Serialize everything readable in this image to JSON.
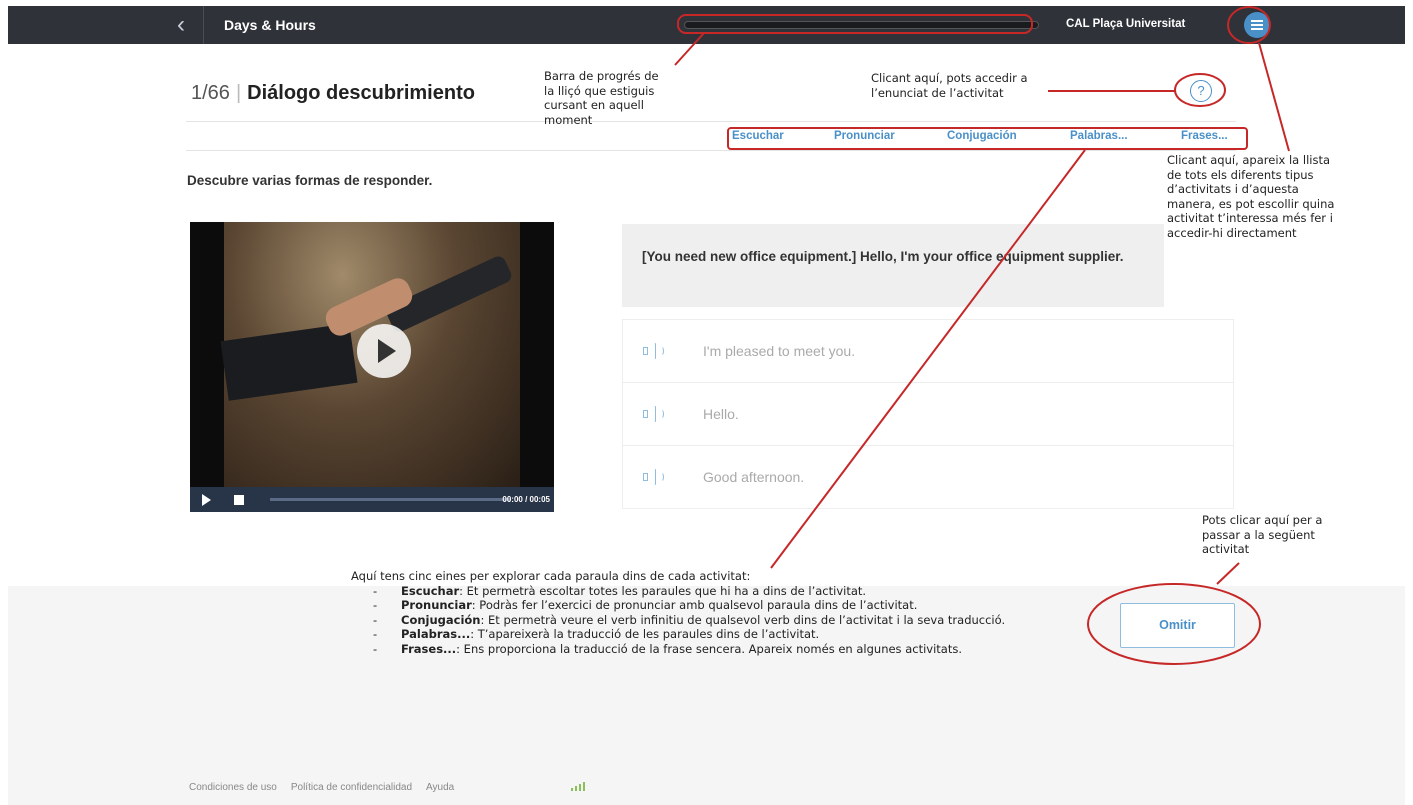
{
  "topbar": {
    "back_icon": "chevron-left-icon",
    "course_title": "Days & Hours",
    "school_name": "CAL Plaça Universitat",
    "menu_icon": "hamburger-menu-icon"
  },
  "lesson": {
    "counter": "1/66",
    "title": "Diálogo descubrimiento",
    "help_icon": "?",
    "instruction": "Descubre varias formas de responder."
  },
  "tools": [
    {
      "label": "Escuchar"
    },
    {
      "label": "Pronunciar"
    },
    {
      "label": "Conjugación"
    },
    {
      "label": "Palabras..."
    },
    {
      "label": "Frases..."
    }
  ],
  "video": {
    "time": "00:00 / 00:05"
  },
  "prompt": "[You need new office equipment.] Hello, I'm your office equipment supplier.",
  "answers": [
    {
      "text": "I'm pleased to meet you."
    },
    {
      "text": "Hello."
    },
    {
      "text": "Good afternoon."
    }
  ],
  "skip_label": "Omitir",
  "footer": {
    "links": [
      "Condiciones de uso",
      "Política de confidencialidad",
      "Ayuda"
    ]
  },
  "annotations": {
    "progress": [
      "Barra de progrés de",
      "la lliçó que estiguis",
      "cursant en aquell",
      "moment"
    ],
    "help": [
      "Clicant aquí, pots accedir a",
      "l’enunciat de l’activitat"
    ],
    "menu": [
      "Clicant aquí, apareix la llista",
      "de tots els diferents tipus",
      "d’activitats i d’aquesta",
      "manera, es pot escollir quina",
      "activitat t’interessa més fer i",
      "accedir-hi directament"
    ],
    "skip": [
      "Pots clicar aquí per a",
      "passar a la següent",
      "activitat"
    ],
    "tools_intro": "Aquí tens cinc eines per explorar cada paraula dins de cada activitat:",
    "tools_list": [
      {
        "name": "Escuchar",
        "desc": ": Et permetrà escoltar totes les paraules que hi ha a dins de l’activitat."
      },
      {
        "name": "Pronunciar",
        "desc": ": Podràs fer l’exercici de pronunciar amb qualsevol paraula dins de l’activitat."
      },
      {
        "name": "Conjugación",
        "desc": ": Et permetrà veure el verb infinitiu de qualsevol verb dins de l’activitat i la seva traducció."
      },
      {
        "name": "Palabras...",
        "desc": ": T’apareixerà la traducció de les paraules dins de l’activitat."
      },
      {
        "name": "Frases...",
        "desc": ": Ens proporciona la traducció de la frase sencera. Apareix només en algunes activitats."
      }
    ],
    "accent_color": "#c62828"
  }
}
